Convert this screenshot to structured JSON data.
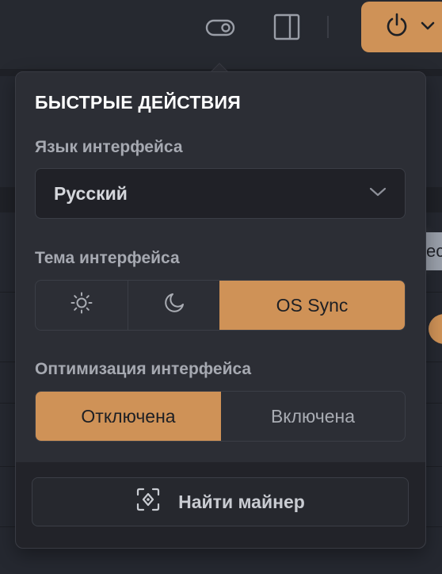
{
  "topbar": {
    "icons": [
      "toggle-icon",
      "panel-layout-icon",
      "power-icon",
      "chevron-down-icon"
    ]
  },
  "quick_actions": {
    "title": "БЫСТРЫЕ ДЕЙСТВИЯ",
    "language": {
      "label": "Язык интерфейса",
      "value": "Русский"
    },
    "theme": {
      "label": "Тема интерфейса",
      "options": [
        {
          "icon": "sun-icon",
          "label": ""
        },
        {
          "icon": "moon-icon",
          "label": ""
        },
        {
          "icon": "",
          "label": "OS Sync"
        }
      ],
      "selected": "OS Sync"
    },
    "optimization": {
      "label": "Оптимизация интерфейса",
      "options": [
        "Отключена",
        "Включена"
      ],
      "selected": "Отключена"
    },
    "find_miner_button": "Найти майнер"
  },
  "background": {
    "partial_text": "ес"
  },
  "colors": {
    "accent": "#cf9257",
    "popover_bg": "#2c2e35",
    "page_bg": "#252830",
    "muted_text": "#a6a9b1"
  }
}
